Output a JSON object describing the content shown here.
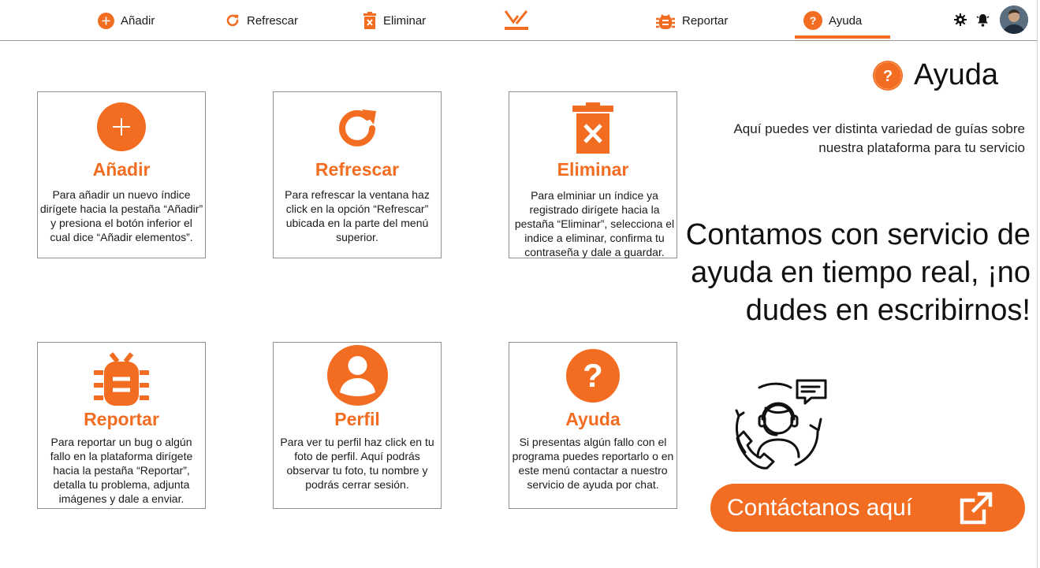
{
  "nav": {
    "add_label": "Añadir",
    "refresh_label": "Refrescar",
    "delete_label": "Eliminar",
    "report_label": "Reportar",
    "help_label": "Ayuda",
    "active_tab": "Ayuda"
  },
  "cards": [
    {
      "title": "Añadir",
      "icon": "plus-circle-icon",
      "desc": "Para añadir un nuevo índice dirígete hacia la pestaña “Añadir” y presiona el botón inferior el cual dice “Añadir elementos”."
    },
    {
      "title": "Refrescar",
      "icon": "refresh-icon",
      "desc": "Para refrescar la ventana haz click en la opción “Refrescar” ubicada en la parte del menú superior."
    },
    {
      "title": "Eliminar",
      "icon": "trash-icon",
      "desc": "Para elminiar un índice ya registrado dirígete hacia la pestaña “Eliminar”, selecciona el indice a eliminar, confirma tu contraseña y dale a guardar."
    },
    {
      "title": "Reportar",
      "icon": "bug-icon",
      "desc": "Para reportar un bug o algún fallo en la plataforma dirígete hacia la pestaña “Reportar”, detalla tu problema, adjunta imágenes y dale a enviar."
    },
    {
      "title": "Perfil",
      "icon": "user-circle-icon",
      "desc": "Para ver tu perfil haz click en tu foto de perfil. Aquí podrás observar tu foto, tu nombre y podrás cerrar sesión."
    },
    {
      "title": "Ayuda",
      "icon": "question-circle-icon",
      "desc": "Si presentas algún fallo con el programa puedes reportarlo o en este menú contactar a nuestro servicio de ayuda por chat."
    }
  ],
  "help": {
    "title": "Ayuda",
    "subtitle": "Aquí puedes ver distinta variedad de guías sobre nuestra plataforma para tu servicio",
    "headline": "Contamos con servicio de ayuda en tiempo real, ¡no dudes en escribirnos!",
    "contact_button": "Contáctanos aquí"
  },
  "colors": {
    "accent": "#f26d21"
  }
}
